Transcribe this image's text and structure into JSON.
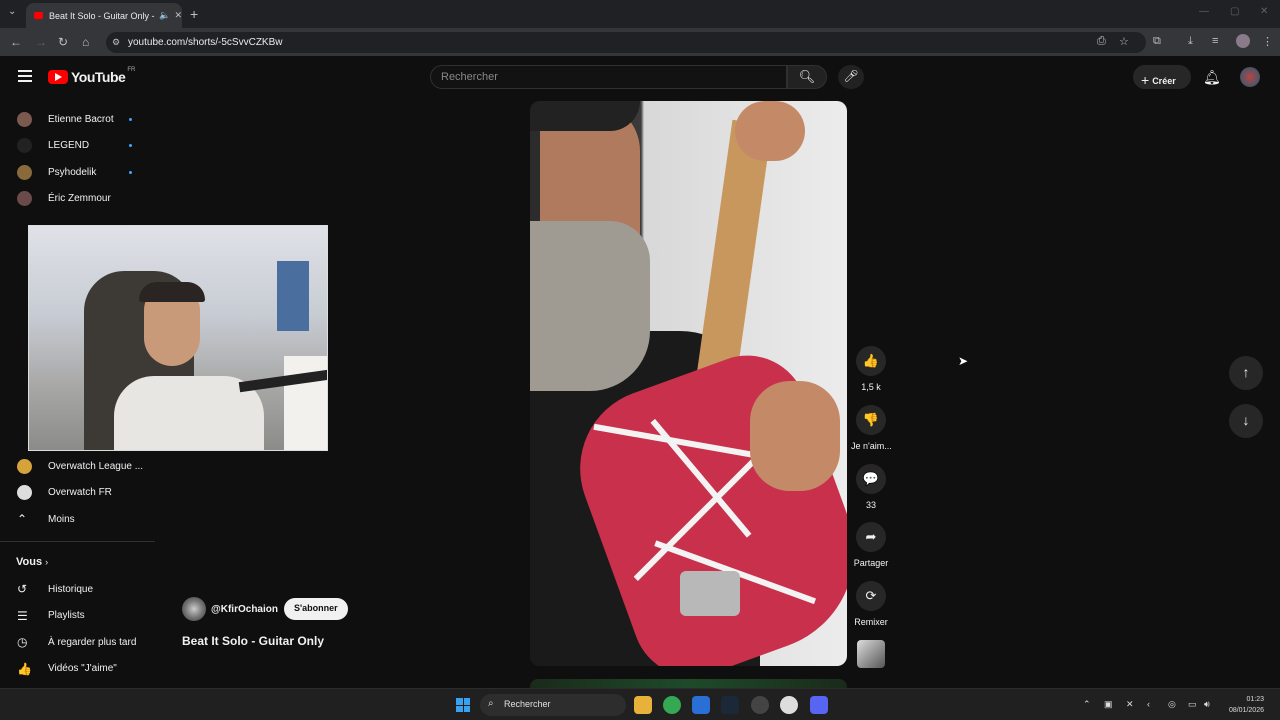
{
  "browser": {
    "tab_title": "Beat It Solo - Guitar Only -",
    "url": "youtube.com/shorts/-5cSvvCZKBw"
  },
  "youtube": {
    "logo_text": "YouTube",
    "region": "FR",
    "search_placeholder": "Rechercher",
    "create_label": "Créer"
  },
  "sidebar": {
    "subscriptions": [
      {
        "label": "Etienne Bacrot",
        "new": true,
        "color": "#7a5a4e"
      },
      {
        "label": "LEGEND",
        "new": true,
        "color": "#222222"
      },
      {
        "label": "Psyhodelik",
        "new": true,
        "color": "#8a6a3a"
      },
      {
        "label": "Éric Zemmour",
        "new": false,
        "color": "#6a4a4a"
      }
    ],
    "more_subscriptions": [
      {
        "label": "Overwatch League ...",
        "color": "#d6a23a"
      },
      {
        "label": "Overwatch FR",
        "color": "#dddddd"
      }
    ],
    "less_label": "Moins",
    "you_section": {
      "title": "Vous",
      "items": [
        {
          "label": "Historique",
          "icon": "history-icon",
          "glyph": "↺"
        },
        {
          "label": "Playlists",
          "icon": "playlists-icon",
          "glyph": "☰"
        },
        {
          "label": "À regarder plus tard",
          "icon": "watch-later-icon",
          "glyph": "◷"
        },
        {
          "label": "Vidéos \"J'aime\"",
          "icon": "liked-icon",
          "glyph": "👍"
        }
      ]
    }
  },
  "short": {
    "channel": "@KfirOchaion",
    "subscribe_label": "S'abonner",
    "title": "Beat It Solo - Guitar Only",
    "actions": [
      {
        "name": "like",
        "icon": "thumbs-up-icon",
        "glyph": "👍",
        "label": "1,5 k"
      },
      {
        "name": "dislike",
        "icon": "thumbs-down-icon",
        "glyph": "👎",
        "label": "Je n'aim..."
      },
      {
        "name": "comments",
        "icon": "comment-icon",
        "glyph": "💬",
        "label": "33"
      },
      {
        "name": "share",
        "icon": "share-icon",
        "glyph": "➦",
        "label": "Partager"
      },
      {
        "name": "remix",
        "icon": "remix-icon",
        "glyph": "⟳",
        "label": "Remixer"
      }
    ]
  },
  "taskbar": {
    "search_label": "Rechercher",
    "time": "01:23",
    "date": "08/01/2026"
  }
}
